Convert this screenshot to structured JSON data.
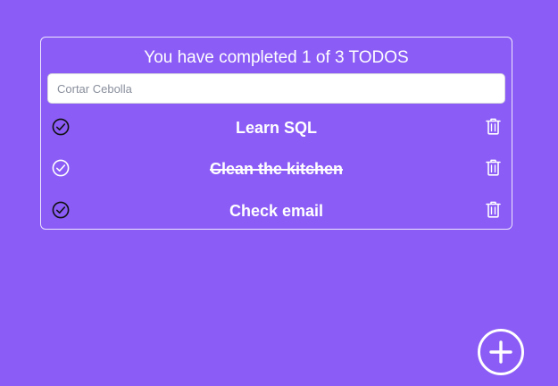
{
  "header": {
    "counter_text": "You have completed 1 of 3 TODOS"
  },
  "search": {
    "placeholder": "Cortar Cebolla"
  },
  "todos": [
    {
      "text": "Learn SQL",
      "completed": false
    },
    {
      "text": "Clean the kitchen",
      "completed": true
    },
    {
      "text": "Check email",
      "completed": false
    }
  ],
  "icons": {
    "check": "check-circle-icon",
    "delete": "trash-icon",
    "add": "plus-circle-icon"
  },
  "colors": {
    "background": "#8b5cf6",
    "text": "#ffffff",
    "check_pending": "#111111",
    "check_done": "#ffffff"
  }
}
